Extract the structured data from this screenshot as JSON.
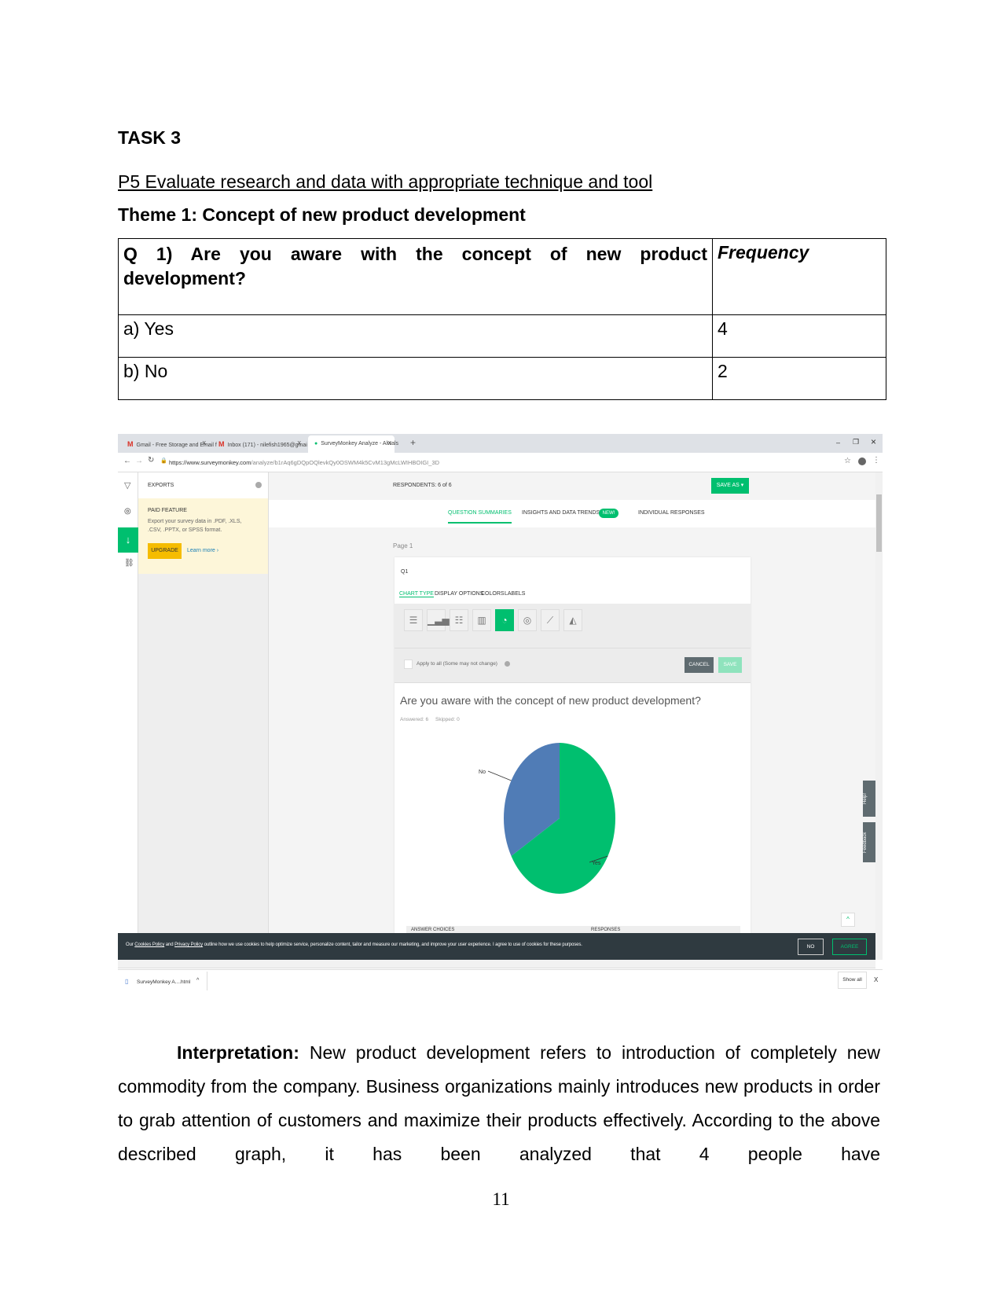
{
  "document": {
    "task_heading": "TASK 3",
    "criterion": "P5 Evaluate research and data with appropriate technique and tool",
    "theme": "Theme 1:  Concept of new product development",
    "table": {
      "question": "Q 1) Are you aware with the concept of new product development?",
      "frequency_header": "Frequency",
      "rows": [
        {
          "option": "a) Yes",
          "frequency": "4"
        },
        {
          "option": "b) No",
          "frequency": "2"
        }
      ]
    },
    "interpretation_label": "Interpretation:",
    "interpretation_text": "New product development refers to introduction of completely new commodity from the company. Business organizations mainly introduces new products in order to grab attention of customers and maximize their products effectively. According to the above described graph, it has been analyzed that 4 people have",
    "page_number": "11"
  },
  "browser": {
    "tabs": [
      {
        "icon": "gmail-icon",
        "label": "Gmail - Free Storage and Email f",
        "close": "X"
      },
      {
        "icon": "gmail-icon",
        "label": "Inbox (171) - nilefish1965@gmai",
        "close": "X"
      },
      {
        "icon": "surveymonkey-icon",
        "label": "SurveyMonkey Analyze - Alwals",
        "close": "X",
        "active": true
      }
    ],
    "new_tab": "+",
    "window_controls": {
      "minimize": "–",
      "restore": "❐",
      "close": "×"
    },
    "url_host": "https://www.surveymonkey.com",
    "url_path": "/analyze/b1rAq6gDQpOQlevkQy0OSWM4k5CvM13gMcLWIHBOIGI_3D",
    "download_file": "SurveyMonkey A....html",
    "show_all": "Show all",
    "download_close": "X"
  },
  "surveymonkey": {
    "sidebar": {
      "exports": "EXPORTS",
      "paid_feature": "PAID FEATURE",
      "paid_desc": "Export your survey data in .PDF, .XLS, .CSV, .PPTX, or SPSS format.",
      "upgrade": "UPGRADE",
      "learn_more": "Learn more ›"
    },
    "respondents": "RESPONDENTS: 6 of 6",
    "save_as": "SAVE AS ▾",
    "tabs": [
      "QUESTION SUMMARIES",
      "INSIGHTS AND DATA TRENDS",
      "INDIVIDUAL RESPONSES"
    ],
    "new_badge": "NEW!",
    "page_label": "Page 1",
    "question_id": "Q1",
    "chart_tabs": [
      "CHART TYPE",
      "DISPLAY OPTIONS",
      "COLORS",
      "LABELS"
    ],
    "chart_types": [
      "horizontal-bar-icon",
      "vertical-bar-icon",
      "stacked-horizontal-bar-icon",
      "stacked-vertical-bar-icon",
      "pie-chart-icon",
      "donut-chart-icon",
      "line-chart-icon",
      "area-chart-icon"
    ],
    "selected_chart_type": "pie-chart-icon",
    "apply_all": "Apply to all (Some may not change)",
    "cancel": "CANCEL",
    "save": "SAVE",
    "question_title": "Are you aware with the concept of new product development?",
    "answered": "Answered: 6",
    "skipped": "Skipped: 0",
    "table_headers": [
      "ANSWER CHOICES",
      "RESPONSES"
    ],
    "help": "Help!",
    "feedback": "Feedback",
    "cookie": {
      "prefix": "Our ",
      "cookies_link": "Cookies Policy",
      "and": " and ",
      "privacy_link": "Privacy Policy",
      "text": " outline how we use cookies to help optimize service, personalize content, tailor and measure our marketing, and improve your user experience. I agree to use of cookies for these purposes.",
      "no": "NO",
      "agree": "AGREE"
    },
    "accent_color": "#00bf6f"
  },
  "chart_data": {
    "type": "pie",
    "categories": [
      "Yes",
      "No"
    ],
    "values": [
      4,
      2
    ],
    "colors": [
      "#00bf6f",
      "#507cb6"
    ]
  }
}
